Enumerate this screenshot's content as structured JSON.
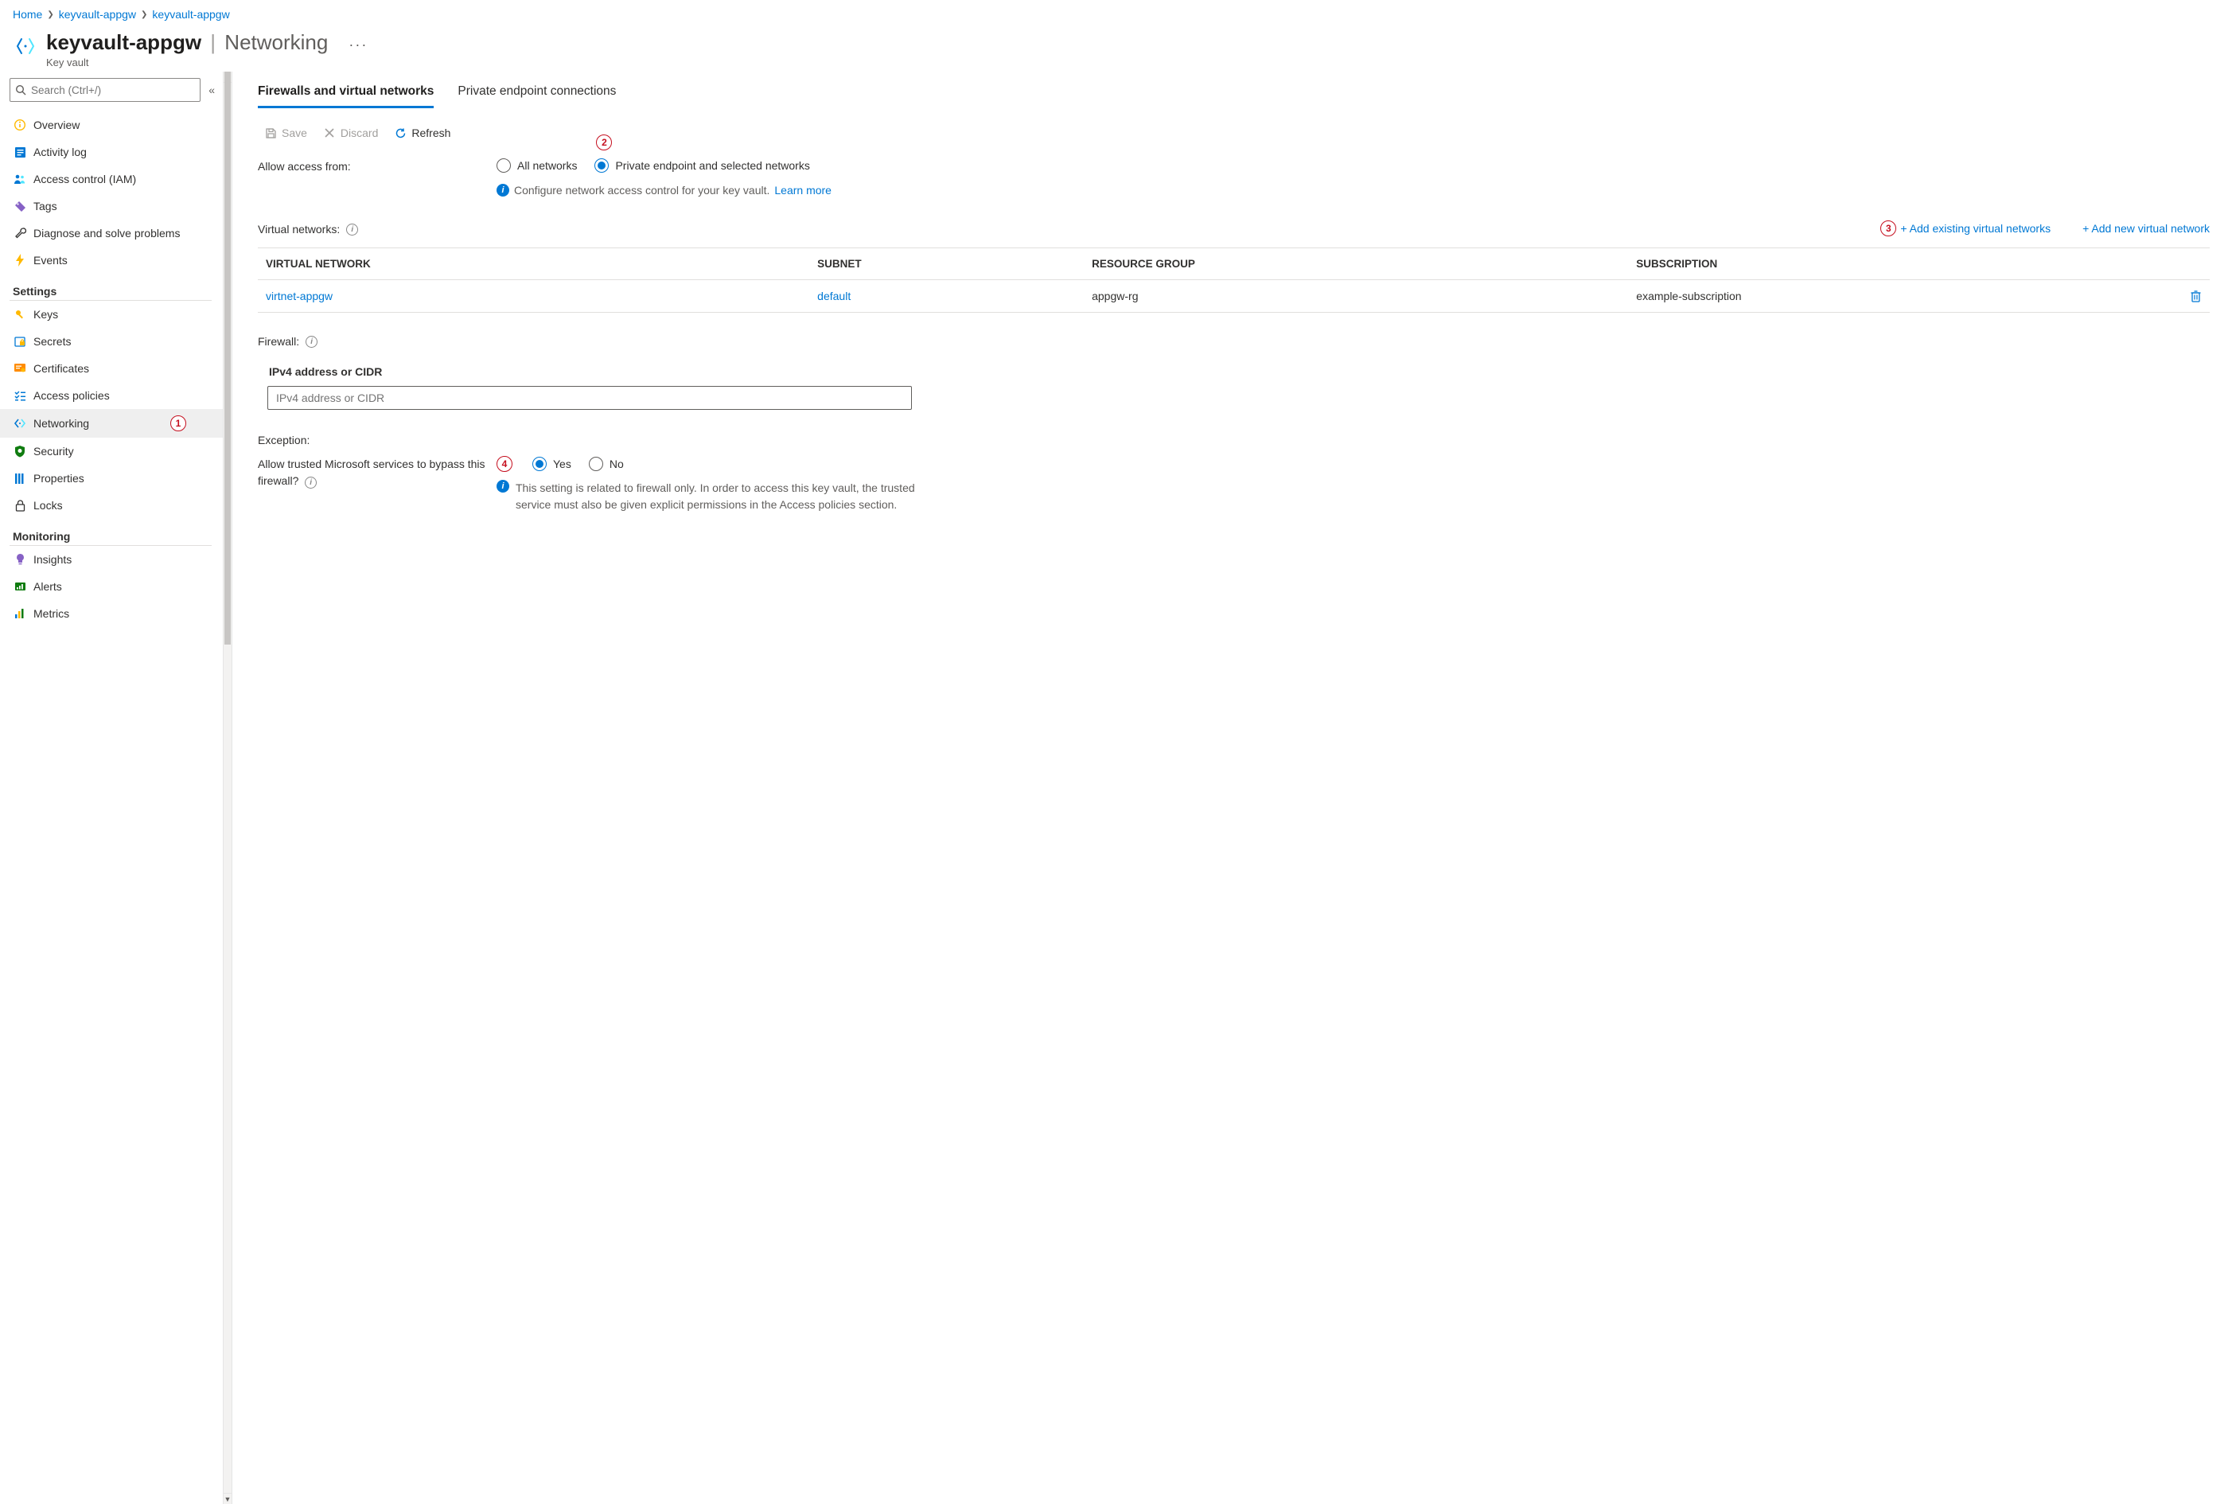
{
  "breadcrumb": {
    "items": [
      "Home",
      "keyvault-appgw",
      "keyvault-appgw"
    ]
  },
  "header": {
    "resource_name": "keyvault-appgw",
    "section": "Networking",
    "subtitle": "Key vault"
  },
  "search": {
    "placeholder": "Search (Ctrl+/)"
  },
  "sidebar": {
    "items": [
      {
        "label": "Overview"
      },
      {
        "label": "Activity log"
      },
      {
        "label": "Access control (IAM)"
      },
      {
        "label": "Tags"
      },
      {
        "label": "Diagnose and solve problems"
      },
      {
        "label": "Events"
      }
    ],
    "settings_heading": "Settings",
    "settings": [
      {
        "label": "Keys"
      },
      {
        "label": "Secrets"
      },
      {
        "label": "Certificates"
      },
      {
        "label": "Access policies"
      },
      {
        "label": "Networking"
      },
      {
        "label": "Security"
      },
      {
        "label": "Properties"
      },
      {
        "label": "Locks"
      }
    ],
    "monitoring_heading": "Monitoring",
    "monitoring": [
      {
        "label": "Insights"
      },
      {
        "label": "Alerts"
      },
      {
        "label": "Metrics"
      }
    ]
  },
  "annotations": {
    "a1": "1",
    "a2": "2",
    "a3": "3",
    "a4": "4"
  },
  "tabs": {
    "firewalls": "Firewalls and virtual networks",
    "private": "Private endpoint connections"
  },
  "toolbar": {
    "save": "Save",
    "discard": "Discard",
    "refresh": "Refresh"
  },
  "access": {
    "label": "Allow access from:",
    "opt_all": "All networks",
    "opt_selected": "Private endpoint and selected networks",
    "info_text": "Configure network access control for your key vault.",
    "learn_more": "Learn more"
  },
  "vnet": {
    "label": "Virtual networks:",
    "add_existing": "+ Add existing virtual networks",
    "add_new": "+ Add new virtual network",
    "cols": {
      "vnet": "VIRTUAL NETWORK",
      "subnet": "SUBNET",
      "rg": "RESOURCE GROUP",
      "sub": "SUBSCRIPTION"
    },
    "rows": [
      {
        "vnet": "virtnet-appgw",
        "subnet": "default",
        "rg": "appgw-rg",
        "sub": "example-subscription"
      }
    ]
  },
  "firewall": {
    "heading": "Firewall:",
    "cidr_label": "IPv4 address or CIDR",
    "cidr_placeholder": "IPv4 address or CIDR"
  },
  "exception": {
    "heading": "Exception:",
    "question": "Allow trusted Microsoft services to bypass this firewall?",
    "yes": "Yes",
    "no": "No",
    "note": "This setting is related to firewall only. In order to access this key vault, the trusted service must also be given explicit permissions in the Access policies section."
  }
}
